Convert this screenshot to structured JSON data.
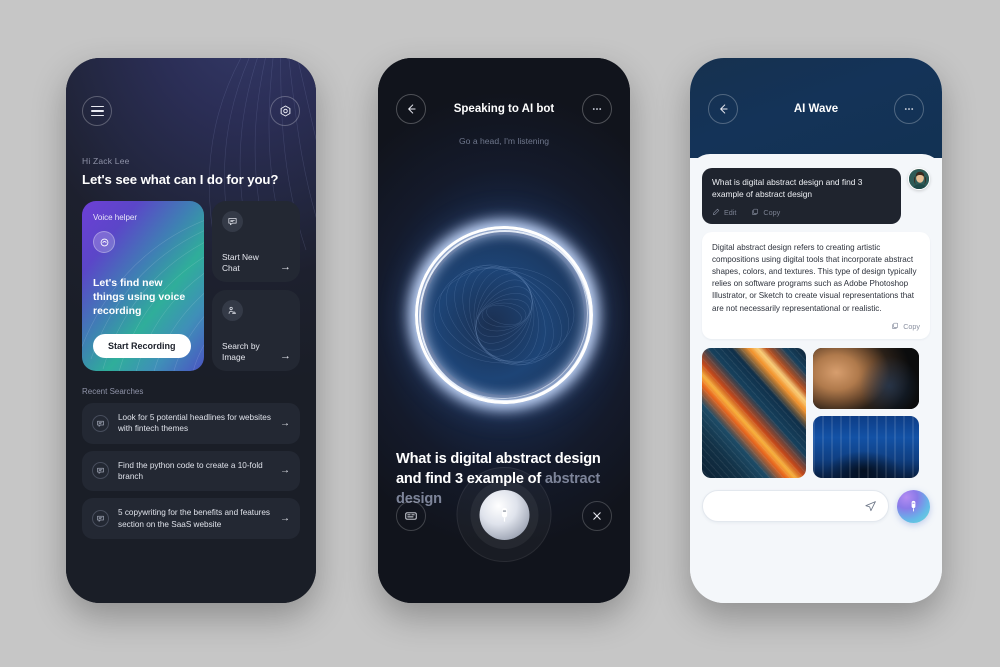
{
  "canvas": {
    "background": "#c6c6c6"
  },
  "phone1": {
    "name": "AI assistant home screen",
    "menu_icon": "hamburger-menu-icon",
    "settings_icon": "gear-icon",
    "greeting": "Hi Zack Lee",
    "headline": "Let's see what can I do for you?",
    "voice_card": {
      "label": "Voice helper",
      "icon": "voice-wave-icon",
      "description": "Let's find new things using voice recording",
      "button": "Start Recording",
      "gradient": [
        "#6d3fd6",
        "#2fae9a",
        "#4a53c2"
      ]
    },
    "quick_cards": [
      {
        "icon": "chat-bubble-icon",
        "label": "Start New Chat",
        "arrow": "→"
      },
      {
        "icon": "image-person-icon",
        "label": "Search by Image",
        "arrow": "→"
      }
    ],
    "recent_title": "Recent Searches",
    "recent_items": [
      {
        "icon": "chat-bubble-icon",
        "text": "Look for 5 potential headlines for websites with fintech themes",
        "arrow": "→"
      },
      {
        "icon": "chat-bubble-icon",
        "text": "Find the python code to create a 10-fold branch",
        "arrow": "→"
      },
      {
        "icon": "chat-bubble-icon",
        "text": "5 copywriting for the benefits and features section on the SaaS website",
        "arrow": "→"
      }
    ]
  },
  "phone2": {
    "name": "Voice listening screen",
    "back_icon": "arrow-left-icon",
    "title": "Speaking to AI bot",
    "more_icon": "more-dots-icon",
    "subtitle": "Go a head, I'm listening",
    "orb": "glowing-ring-visualizer",
    "transcript_spoken": "What is digital abstract design and find 3 example of ",
    "transcript_pending": "abstract design",
    "controls": {
      "keyboard_icon": "keyboard-icon",
      "mic_icon": "microphone-icon",
      "close_icon": "close-x-icon"
    }
  },
  "phone3": {
    "name": "AI chat conversation screen",
    "back_icon": "arrow-left-icon",
    "title": "AI Wave",
    "more_icon": "more-dots-icon",
    "user_message": {
      "text": "What is digital abstract design and find 3 example of abstract design",
      "actions": [
        {
          "icon": "pencil-edit-icon",
          "label": "Edit"
        },
        {
          "icon": "copy-icon",
          "label": "Copy"
        }
      ],
      "avatar": "user-avatar"
    },
    "ai_message": {
      "text": "Digital abstract design refers to creating artistic compositions using digital tools that incorporate abstract shapes, colors, and textures. This type of design typically relies on software programs such as Adobe Photoshop Illustrator, or Sketch to create visual representations that are not necessarily representational or realistic.",
      "copy_icon": "copy-icon",
      "copy_label": "Copy"
    },
    "images": [
      {
        "name": "abstract-light-streaks",
        "alt": "Orange and blue diagonal light streaks"
      },
      {
        "name": "abstract-smoke-swirl",
        "alt": "Tan and black smoke swirl on dark background"
      },
      {
        "name": "abstract-blue-forest",
        "alt": "Blue vertical streak abstract"
      }
    ],
    "input": {
      "value": "",
      "placeholder": "",
      "send_icon": "send-paper-plane-icon",
      "mic_icon": "microphone-icon"
    }
  }
}
